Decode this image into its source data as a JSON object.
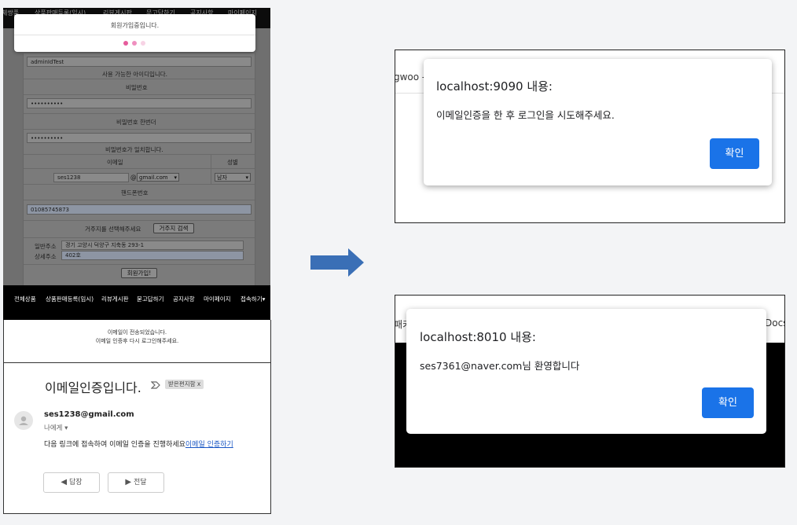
{
  "signup_page": {
    "top_nav": [
      "체쌍품",
      "상품판매등록(임시)",
      "리뷰게시판",
      "문고답하기",
      "공지사항",
      "마이페이지"
    ],
    "toast": {
      "message": "회원가입중입니다."
    },
    "form": {
      "id_value": "adminIdTest",
      "id_status": "사용 가능한 아이디입니다.",
      "password_label": "비밀번호",
      "password_value": "••••••••••",
      "password_confirm_label": "비밀번호 한번더",
      "password_confirm_value": "••••••••••",
      "password_status": "비밀번호가 일치합니다.",
      "email_label": "이메일",
      "gender_label": "성별",
      "email_local": "ses1238",
      "email_at": "@",
      "email_domain": "gmail.com",
      "gender_value": "남자",
      "phone_label": "핸드폰번호",
      "phone_value": "01085745873",
      "address_prompt": "거주지를 선택해주세요",
      "address_search_button": "거주지 검색",
      "general_address_label": "일반주소",
      "general_address_value": "경기 고양시 덕양구 지축동 293-1",
      "detail_address_label": "상세주소",
      "detail_address_value": "402호",
      "submit_button": "회원가입!"
    }
  },
  "main_nav": [
    "전체상품",
    "상품판매등록(임시)",
    "리뷰게시판",
    "묻고답하기",
    "공지사항",
    "마이페이지",
    "접속하기▾"
  ],
  "notice": {
    "line1": "이메일이 전송되었습니다.",
    "line2": "이메일 인증후 다시 로그인해주세요."
  },
  "email_message": {
    "subject": "이메일인증입니다.",
    "label_badge": "받은편지함 x",
    "sender": "ses1238@gmail.com",
    "recipient": "나에게 ▾",
    "body_text": "다음 링크에 접속하여 이메일 인증을 진행하세요",
    "link_text": "이메일 인증하기",
    "reply_button": "답장",
    "forward_button": "전달"
  },
  "dialog_top": {
    "background_tab_text": "gwoo -",
    "title": "localhost:9090 내용:",
    "message": "이메일인증을 한 후 로그인을 시도해주세요.",
    "ok_button": "확인"
  },
  "dialog_bottom": {
    "background_left_text": "패키",
    "background_right_text": "Docs",
    "title": "localhost:8010 내용:",
    "message": "ses7361@naver.com님 환영합니다",
    "ok_button": "확인"
  },
  "colors": {
    "accent_blue": "#1a73e8",
    "arrow_blue": "#3a6fb6",
    "toast_dot": "#e65c9c",
    "link": "#1a57c4"
  }
}
